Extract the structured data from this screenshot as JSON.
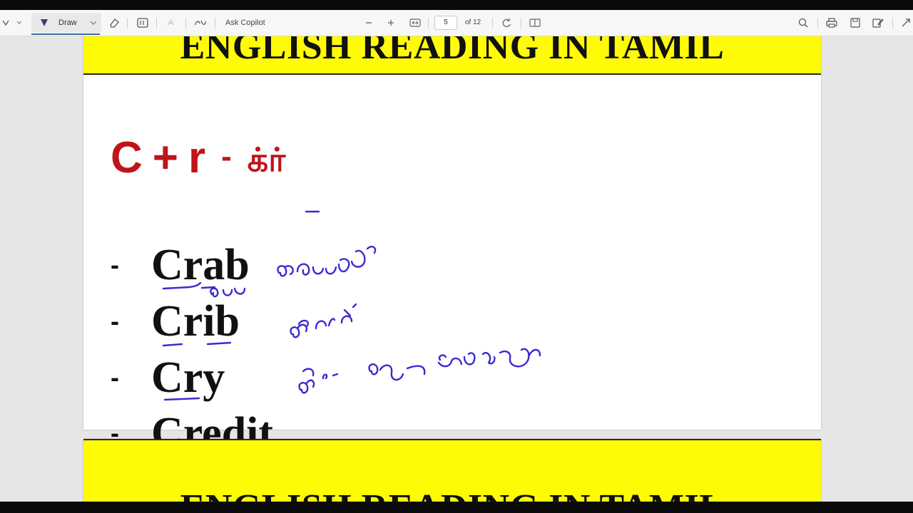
{
  "toolbar": {
    "draw_label": "Draw",
    "ask_copilot_label": "Ask Copilot",
    "page_number": "5",
    "page_total": "of 12"
  },
  "document": {
    "banner_title": "ENGLISH READING IN TAMIL",
    "formula": {
      "letter1": "C",
      "plus": "+",
      "letter2": "r",
      "dash": "-",
      "tamil": "க்ர்"
    },
    "words": [
      {
        "bullet": "-",
        "text": "Crab"
      },
      {
        "bullet": "-",
        "text": "Crib"
      },
      {
        "bullet": "-",
        "text": "Cry"
      },
      {
        "bullet": "-",
        "text": "Credit"
      }
    ],
    "next_page_banner_title": "ENGLISH READING IN TAMIL"
  },
  "colors": {
    "banner": "#fffb06",
    "formula": "#c0141b",
    "ink": "#3a2ad0"
  }
}
